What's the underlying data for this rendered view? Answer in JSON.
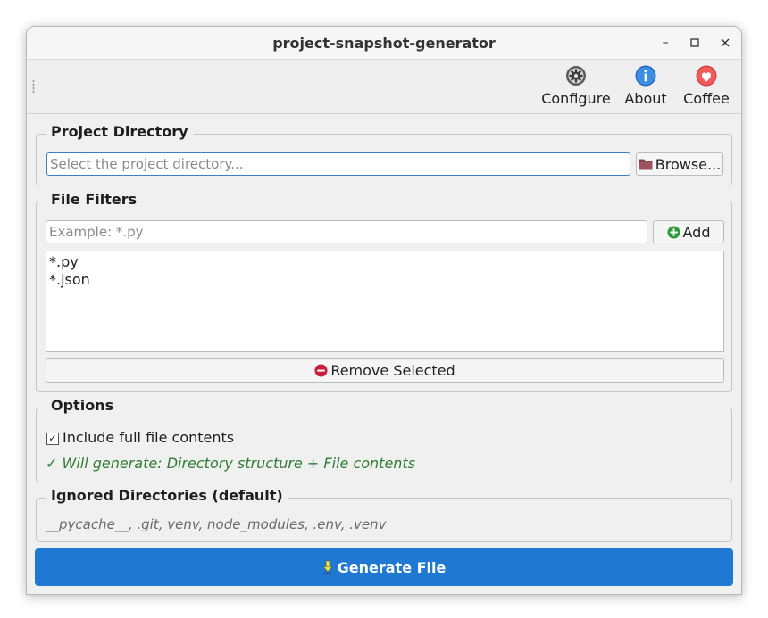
{
  "window": {
    "title": "project-snapshot-generator",
    "minimize": "–",
    "maximize": "☐",
    "close": "✕"
  },
  "toolbar": {
    "items": [
      {
        "label": "Configure",
        "icon": "gear-icon"
      },
      {
        "label": "About",
        "icon": "info-icon"
      },
      {
        "label": "Coffee",
        "icon": "heart-icon"
      }
    ]
  },
  "project_directory": {
    "title": "Project Directory",
    "placeholder": "Select the project directory...",
    "value": "",
    "browse_label": "Browse..."
  },
  "file_filters": {
    "title": "File Filters",
    "placeholder": "Example: *.py",
    "add_label": "Add",
    "items": [
      "*.py",
      "*.json"
    ],
    "remove_label": "Remove Selected"
  },
  "options": {
    "title": "Options",
    "include_label": "Include full file contents",
    "include_checked": true,
    "status": "✓ Will generate: Directory structure + File contents",
    "status_color": "#2e7d32"
  },
  "ignored": {
    "title": "Ignored Directories (default)",
    "text": "__pycache__, .git, venv, node_modules, .env, .venv"
  },
  "generate": {
    "label": "Generate File",
    "color": "#1f78d1"
  }
}
